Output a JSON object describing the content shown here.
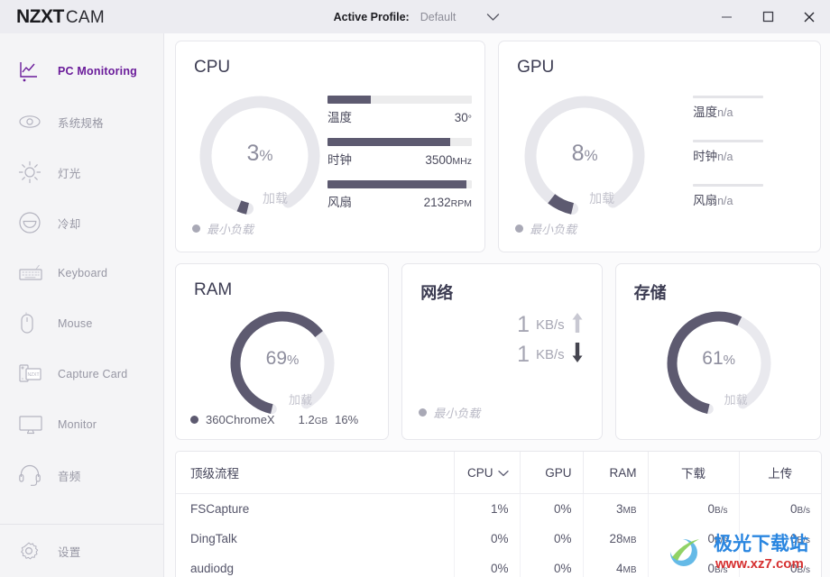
{
  "titlebar": {
    "brand_primary": "NZXT",
    "brand_secondary": "CAM",
    "profile_label": "Active Profile:",
    "profile_value": "Default",
    "caret_icon": "chevron-down-icon",
    "minimize_icon": "minimize-icon",
    "maximize_icon": "maximize-icon",
    "close_icon": "close-icon"
  },
  "sidebar": {
    "items": [
      {
        "label": "PC Monitoring",
        "icon": "line-chart-icon",
        "active": true
      },
      {
        "label": "系统规格",
        "icon": "eye-icon",
        "active": false
      },
      {
        "label": "灯光",
        "icon": "sun-icon",
        "active": false
      },
      {
        "label": "冷却",
        "icon": "cooling-icon",
        "active": false
      },
      {
        "label": "Keyboard",
        "icon": "keyboard-icon",
        "active": false
      },
      {
        "label": "Mouse",
        "icon": "mouse-icon",
        "active": false
      },
      {
        "label": "Capture Card",
        "icon": "capture-card-icon",
        "active": false
      },
      {
        "label": "Monitor",
        "icon": "monitor-icon",
        "active": false
      },
      {
        "label": "音频",
        "icon": "headset-icon",
        "active": false
      }
    ],
    "settings": {
      "label": "设置",
      "icon": "gear-icon"
    }
  },
  "cards": {
    "cpu": {
      "title": "CPU",
      "gauge_value": "3",
      "gauge_unit": "%",
      "gauge_percent": 3,
      "gauge_caption": "加载",
      "legend_text": "最小负载",
      "stats": [
        {
          "name": "温度",
          "value": "30",
          "unit": "°",
          "fill_percent": 30
        },
        {
          "name": "时钟",
          "value": "3500",
          "unit": "MHz",
          "fill_percent": 85
        },
        {
          "name": "风扇",
          "value": "2132",
          "unit": "RPM",
          "fill_percent": 96
        }
      ]
    },
    "gpu": {
      "title": "GPU",
      "gauge_value": "8",
      "gauge_unit": "%",
      "gauge_percent": 8,
      "gauge_caption": "加载",
      "legend_text": "最小负载",
      "stats": [
        {
          "name": "温度",
          "value": "n/a",
          "fill_percent": 0
        },
        {
          "name": "时钟",
          "value": "n/a",
          "fill_percent": 0
        },
        {
          "name": "风扇",
          "value": "n/a",
          "fill_percent": 0
        }
      ]
    },
    "ram": {
      "title": "RAM",
      "gauge_value": "69",
      "gauge_unit": "%",
      "gauge_percent": 69,
      "gauge_caption": "加载",
      "process_name": "360ChromeX",
      "process_size": "1.2",
      "process_size_unit": "GB",
      "process_percent": "16%"
    },
    "network": {
      "title": "网络",
      "upload_value": "1",
      "upload_unit": "KB/s",
      "upload_icon": "arrow-up-icon",
      "download_value": "1",
      "download_unit": "KB/s",
      "download_icon": "arrow-down-icon",
      "legend_text": "最小负载"
    },
    "storage": {
      "title": "存储",
      "gauge_value": "61",
      "gauge_unit": "%",
      "gauge_percent": 61,
      "gauge_caption": "加载"
    }
  },
  "process_table": {
    "columns": [
      {
        "label": "顶级流程",
        "sorted": false
      },
      {
        "label": "CPU",
        "sorted": true,
        "sort_icon": "chevron-down-icon"
      },
      {
        "label": "GPU",
        "sorted": false
      },
      {
        "label": "RAM",
        "sorted": false
      },
      {
        "label": "下载",
        "sorted": false
      },
      {
        "label": "上传",
        "sorted": false
      }
    ],
    "rows": [
      {
        "name": "FSCapture",
        "cpu": "1%",
        "gpu": "0%",
        "ram": "3",
        "ram_unit": "MB",
        "download": "0",
        "download_unit": "B/s",
        "upload": "0",
        "upload_unit": "B/s"
      },
      {
        "name": "DingTalk",
        "cpu": "0%",
        "gpu": "0%",
        "ram": "28",
        "ram_unit": "MB",
        "download": "0",
        "download_unit": "B/s",
        "upload": "0",
        "upload_unit": "B/s"
      },
      {
        "name": "audiodg",
        "cpu": "0%",
        "gpu": "0%",
        "ram": "4",
        "ram_unit": "MB",
        "download": "0",
        "download_unit": "B/s",
        "upload": "0",
        "upload_unit": "B/s"
      }
    ]
  },
  "watermark": {
    "title": "极光下载站",
    "url": "www.xz7.com"
  },
  "colors": {
    "accent_purple": "#6a1b9a",
    "gauge_fill": "#5d5a70",
    "gauge_track": "#e6e6ea",
    "titlebar_bg": "#ececf1",
    "sidebar_bg": "#f4f4f6"
  }
}
